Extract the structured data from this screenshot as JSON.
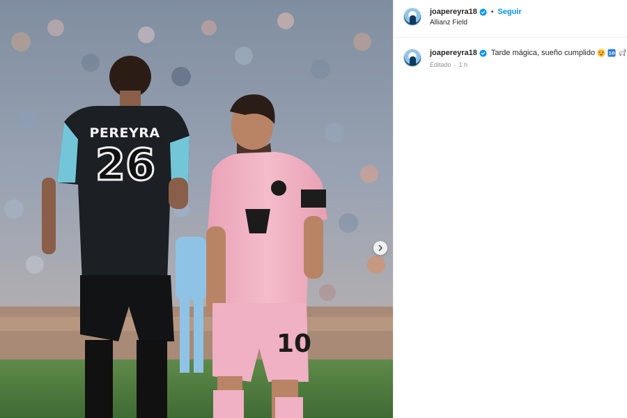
{
  "media": {
    "jersey_name": "PEREYRA",
    "jersey_number": "26",
    "shorts_number": "10",
    "next_icon": "chevron-right-icon"
  },
  "post": {
    "username": "joapereyra18",
    "follow_label": "Seguir",
    "location": "Allianz Field",
    "separator": "•"
  },
  "caption": {
    "username": "joapereyra18",
    "text": "Tarde mágica, sueño cumplido",
    "emojis": [
      "star-struck-emoji-icon",
      "number-10-keycap-icon",
      "goat-emoji-icon"
    ],
    "edited_label": "Editado",
    "meta_separator": "·",
    "time": "1 h"
  },
  "colors": {
    "link_blue": "#0095f6",
    "text": "#262626",
    "muted": "#8e8e8e",
    "divider": "#efefef"
  }
}
